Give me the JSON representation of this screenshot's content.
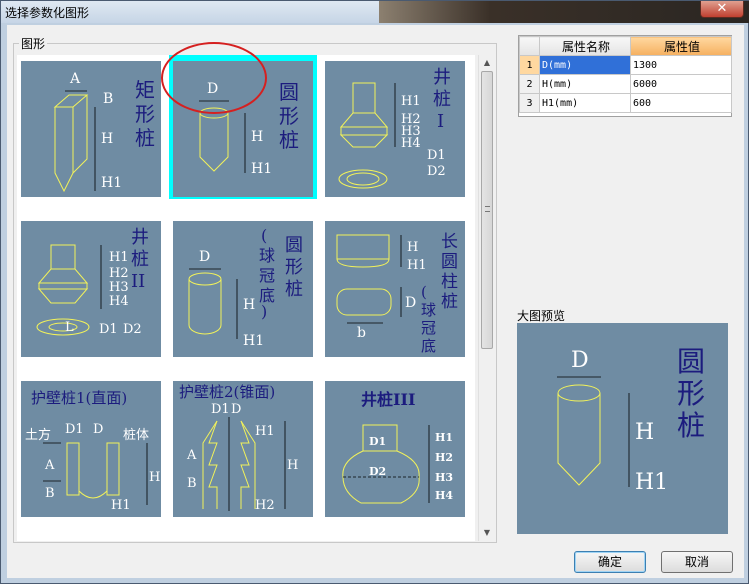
{
  "window": {
    "title": "选择参数化图形",
    "close_label": "✕"
  },
  "gallery": {
    "group_label": "图形",
    "selected_index": 1,
    "items": [
      {
        "caption": "矩形桩",
        "dims": [
          "A",
          "B",
          "H",
          "H1"
        ]
      },
      {
        "caption": "圆形桩",
        "dims": [
          "D",
          "H",
          "H1"
        ]
      },
      {
        "caption": "井桩I",
        "dims": [
          "H1",
          "H2",
          "H3",
          "H4",
          "D1",
          "D2"
        ]
      },
      {
        "caption": "井桩II",
        "dims": [
          "H1",
          "H2",
          "H3",
          "H4",
          "L",
          "D1",
          "D2"
        ]
      },
      {
        "caption": "圆形桩(球冠底)",
        "dims": [
          "D",
          "H",
          "H1"
        ]
      },
      {
        "caption": "长圆柱桩(球冠底)",
        "dims": [
          "H",
          "H1",
          "D",
          "b"
        ]
      },
      {
        "caption": "护壁桩1(直面)",
        "dims": [
          "土方",
          "D1",
          "D",
          "桩体",
          "A",
          "B",
          "H",
          "H1"
        ]
      },
      {
        "caption": "护壁桩2(锥面)",
        "dims": [
          "D1",
          "D",
          "H1",
          "A",
          "H",
          "B",
          "H2"
        ]
      },
      {
        "caption": "井桩III",
        "dims": [
          "D1",
          "D2",
          "H1",
          "H2",
          "H3",
          "H4"
        ]
      }
    ]
  },
  "properties": {
    "headers": [
      "属性名称",
      "属性值"
    ],
    "rows": [
      {
        "num": "1",
        "name": "D(mm)",
        "value": "1300"
      },
      {
        "num": "2",
        "name": "H(mm)",
        "value": "6000"
      },
      {
        "num": "3",
        "name": "H1(mm)",
        "value": "600"
      }
    ]
  },
  "preview": {
    "label": "大图预览",
    "caption": "圆形桩",
    "dims": [
      "D",
      "H",
      "H1"
    ]
  },
  "buttons": {
    "ok": "确定",
    "cancel": "取消"
  },
  "colors": {
    "thumb_bg": "#6f8ca3",
    "selection": "#00ffff",
    "caption": "#1c1c7e",
    "outline": "#f2f25a",
    "highlight_circle": "#d52020"
  }
}
